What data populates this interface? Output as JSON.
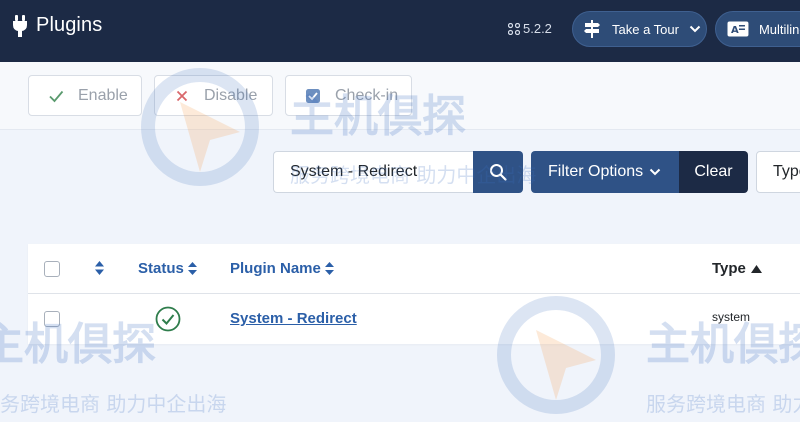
{
  "header": {
    "title": "Plugins",
    "version": "5.2.2",
    "tour_label": "Take a Tour",
    "multilingual_label": "Multilingual"
  },
  "toolbar": {
    "enable_label": "Enable",
    "disable_label": "Disable",
    "checkin_label": "Check-in"
  },
  "filter": {
    "search_value": "System - Redirect",
    "filter_options_label": "Filter Options",
    "clear_label": "Clear",
    "type_select_value": "Type"
  },
  "table": {
    "columns": {
      "status": "Status",
      "plugin_name": "Plugin Name",
      "type": "Type"
    },
    "rows": [
      {
        "name": "System - Redirect",
        "type": "system",
        "status": "enabled"
      }
    ]
  },
  "watermark": {
    "line1": "主机倶探",
    "line2": "服务跨境电商 助力中企出海"
  },
  "colors": {
    "header_bg": "#1c2a45",
    "primary": "#2f5286",
    "link": "#2b5fa8",
    "success": "#2f7d4c"
  }
}
